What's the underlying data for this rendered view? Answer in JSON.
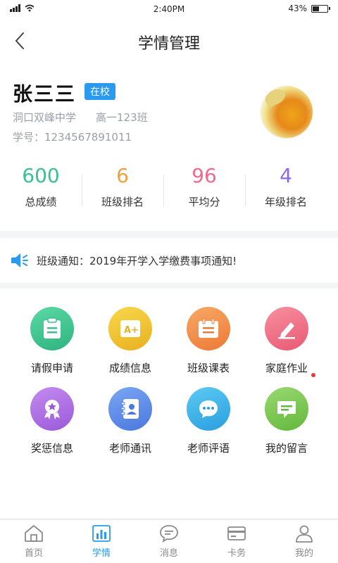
{
  "status_bar": {
    "time": "2:40PM",
    "battery": "43%"
  },
  "nav": {
    "title": "学情管理"
  },
  "profile": {
    "name": "张三三",
    "status_badge": "在校",
    "school": "洞口双峰中学",
    "class": "高一123班",
    "student_id": "学号：1234567891011"
  },
  "stats": [
    {
      "value": "600",
      "label": "总成绩",
      "color": "#3cc08e"
    },
    {
      "value": "6",
      "label": "班级排名",
      "color": "#f0a040"
    },
    {
      "value": "96",
      "label": "平均分",
      "color": "#f06a8a"
    },
    {
      "value": "4",
      "label": "年级排名",
      "color": "#8a6ae0"
    }
  ],
  "notice": {
    "text": "班级通知：2019年开学入学缴费事项通知!"
  },
  "features": [
    {
      "label": "请假申请",
      "icon": "leave-request-icon",
      "color": "#3cc08e"
    },
    {
      "label": "成绩信息",
      "icon": "grades-icon",
      "color": "#f0c030"
    },
    {
      "label": "班级课表",
      "icon": "schedule-icon",
      "color": "#f0904a"
    },
    {
      "label": "家庭作业",
      "icon": "homework-icon",
      "color": "#f06a80"
    },
    {
      "label": "奖惩信息",
      "icon": "award-icon",
      "color": "#a86ae0"
    },
    {
      "label": "老师通讯",
      "icon": "contacts-icon",
      "color": "#5a8ae8"
    },
    {
      "label": "老师评语",
      "icon": "comment-icon",
      "color": "#3ab0ea"
    },
    {
      "label": "我的留言",
      "icon": "message-icon",
      "color": "#7cc850"
    }
  ],
  "tabs": [
    {
      "label": "首页",
      "icon": "home-icon"
    },
    {
      "label": "学情",
      "icon": "chart-icon",
      "active": true
    },
    {
      "label": "消息",
      "icon": "chat-icon"
    },
    {
      "label": "卡务",
      "icon": "card-icon"
    },
    {
      "label": "我的",
      "icon": "user-icon"
    }
  ]
}
